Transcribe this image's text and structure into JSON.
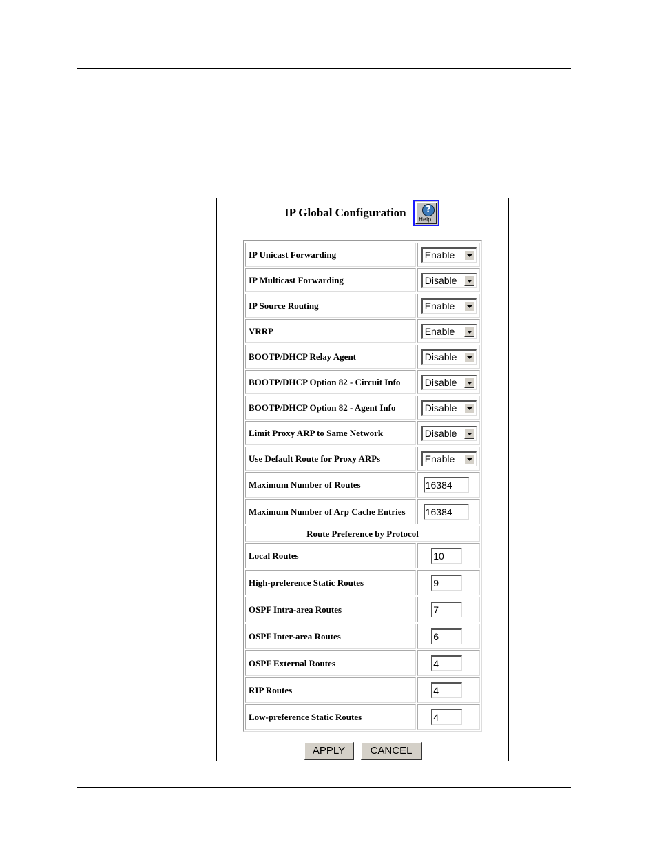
{
  "page": {
    "title": "IP Global Configuration",
    "help_label": "Help",
    "help_glyph": "?"
  },
  "settings": [
    {
      "label": "IP Unicast Forwarding",
      "type": "select",
      "value": "Enable"
    },
    {
      "label": "IP Multicast Forwarding",
      "type": "select",
      "value": "Disable"
    },
    {
      "label": "IP Source Routing",
      "type": "select",
      "value": "Enable"
    },
    {
      "label": "VRRP",
      "type": "select",
      "value": "Enable"
    },
    {
      "label": "BOOTP/DHCP Relay Agent",
      "type": "select",
      "value": "Disable"
    },
    {
      "label": "BOOTP/DHCP Option 82 - Circuit Info",
      "type": "select",
      "value": "Disable"
    },
    {
      "label": "BOOTP/DHCP Option 82 - Agent Info",
      "type": "select",
      "value": "Disable"
    },
    {
      "label": "Limit Proxy ARP to Same Network",
      "type": "select",
      "value": "Disable"
    },
    {
      "label": "Use Default Route for Proxy ARPs",
      "type": "select",
      "value": "Enable"
    },
    {
      "label": "Maximum Number of Routes",
      "type": "text",
      "value": "16384"
    },
    {
      "label": "Maximum Number of Arp Cache Entries",
      "type": "text",
      "value": "16384"
    }
  ],
  "route_preference": {
    "heading": "Route Preference by Protocol",
    "items": [
      {
        "label": "Local Routes",
        "value": "10"
      },
      {
        "label": "High-preference Static Routes",
        "value": "9"
      },
      {
        "label": "OSPF Intra-area Routes",
        "value": "7"
      },
      {
        "label": "OSPF Inter-area Routes",
        "value": "6"
      },
      {
        "label": "OSPF External Routes",
        "value": "4"
      },
      {
        "label": "RIP Routes",
        "value": "4"
      },
      {
        "label": "Low-preference Static Routes",
        "value": "4"
      }
    ]
  },
  "buttons": {
    "apply": "APPLY",
    "cancel": "CANCEL"
  },
  "colors": {
    "help_border": "#1a1aff",
    "button_face": "#d4d0c8"
  }
}
